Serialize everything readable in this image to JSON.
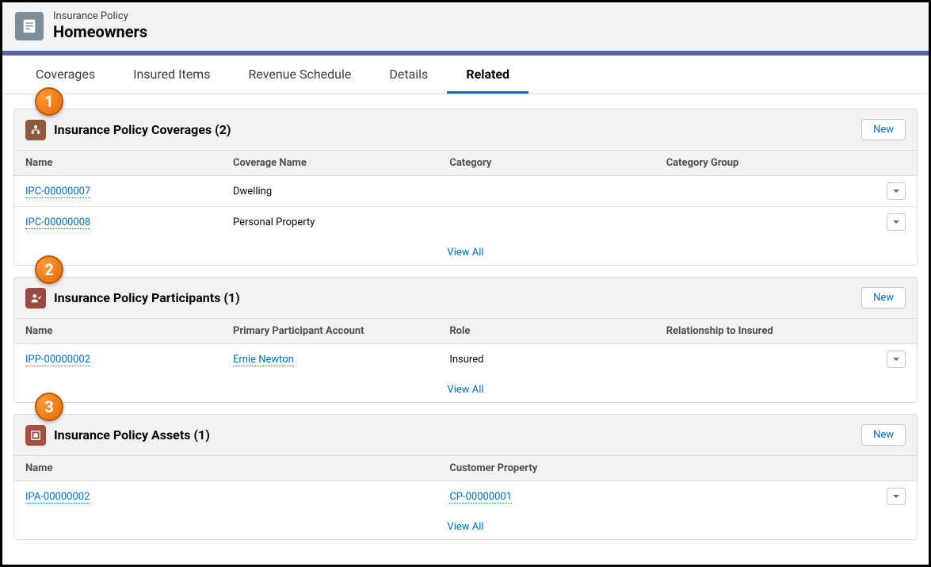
{
  "header": {
    "eyebrow": "Insurance Policy",
    "title": "Homeowners"
  },
  "tabs": [
    {
      "label": "Coverages",
      "active": false
    },
    {
      "label": "Insured Items",
      "active": false
    },
    {
      "label": "Revenue Schedule",
      "active": false
    },
    {
      "label": "Details",
      "active": false
    },
    {
      "label": "Related",
      "active": true
    }
  ],
  "sections": {
    "coverages": {
      "callout": "1",
      "title": "Insurance Policy Coverages (2)",
      "new_label": "New",
      "headers": [
        "Name",
        "Coverage Name",
        "Category",
        "Category Group"
      ],
      "rows": [
        {
          "name": "IPC-00000007",
          "coverage": "Dwelling",
          "category": "",
          "group": ""
        },
        {
          "name": "IPC-00000008",
          "coverage": "Personal Property",
          "category": "",
          "group": ""
        }
      ],
      "view_all": "View All"
    },
    "participants": {
      "callout": "2",
      "title": "Insurance Policy Participants (1)",
      "new_label": "New",
      "headers": [
        "Name",
        "Primary Participant Account",
        "Role",
        "Relationship to Insured"
      ],
      "rows": [
        {
          "name": "IPP-00000002",
          "account": "Ernie Newton",
          "role": "Insured",
          "relationship": ""
        }
      ],
      "view_all": "View All"
    },
    "assets": {
      "callout": "3",
      "title": "Insurance Policy Assets (1)",
      "new_label": "New",
      "headers": [
        "Name",
        "Customer Property"
      ],
      "rows": [
        {
          "name": "IPA-00000002",
          "property": "CP-00000001"
        }
      ],
      "view_all": "View All"
    }
  }
}
